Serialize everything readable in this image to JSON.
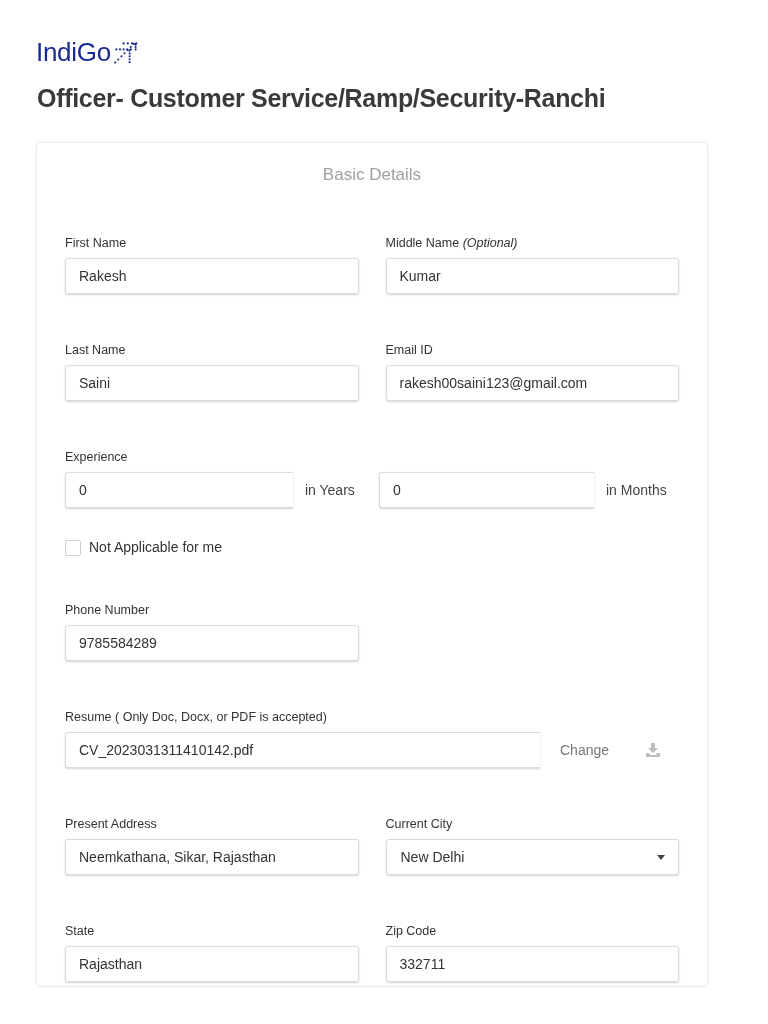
{
  "logo": {
    "text": "IndiGo"
  },
  "job_title": "Officer- Customer Service/Ramp/Security-Ranchi",
  "form": {
    "section_title": "Basic Details",
    "rows": [
      {
        "kind": "fields",
        "fields": [
          {
            "kind": "text",
            "label": "First Name",
            "value": "Rakesh"
          },
          {
            "kind": "text",
            "label": "Middle Name *(Optional)*",
            "value": "Kumar"
          }
        ]
      },
      {
        "kind": "fields",
        "fields": [
          {
            "kind": "text",
            "label": "Last Name",
            "value": "Saini"
          },
          {
            "kind": "text",
            "label": "Email ID",
            "value": "rakesh00saini123@gmail.com"
          }
        ]
      },
      {
        "kind": "experience",
        "label": "Experience",
        "parts": [
          {
            "value": "0",
            "unit": "in Years"
          },
          {
            "value": "0",
            "unit": "in Months"
          }
        ]
      },
      {
        "kind": "checkbox",
        "label": "Not Applicable for me",
        "checked": false
      },
      {
        "kind": "fields",
        "fields": [
          {
            "kind": "text",
            "label": "Phone Number",
            "value": "9785584289"
          }
        ]
      },
      {
        "kind": "file",
        "label": "Resume ( Only Doc, Docx, or PDF is accepted)",
        "file_name": "CV_2023031311410142.pdf",
        "action": "Change"
      },
      {
        "kind": "fields",
        "fields": [
          {
            "kind": "text",
            "label": "Present Address",
            "value": "Neemkathana, Sikar, Rajasthan"
          },
          {
            "kind": "select",
            "label": "Current City",
            "value": "New Delhi"
          }
        ]
      },
      {
        "kind": "fields",
        "fields": [
          {
            "kind": "text",
            "label": "State",
            "value": "Rajasthan"
          },
          {
            "kind": "text",
            "label": "Zip Code",
            "value": "332711"
          }
        ]
      }
    ]
  }
}
